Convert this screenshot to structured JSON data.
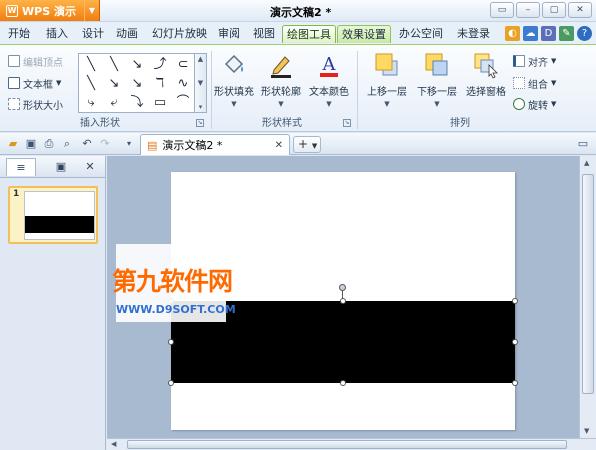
{
  "app": {
    "button_label": "WPS 演示",
    "doc_title": "演示文稿2 *"
  },
  "window_controls": [
    "▭",
    "–",
    "▢",
    "✕"
  ],
  "menu": {
    "tabs": [
      "开始",
      "插入",
      "设计",
      "动画",
      "幻灯片放映",
      "审阅",
      "视图",
      "绘图工具",
      "效果设置",
      "办公空间"
    ],
    "active_tab": "绘图工具",
    "login": "未登录"
  },
  "ribbon": {
    "insert_shape": {
      "edit_points": "编辑顶点",
      "textbox": "文本框",
      "shape_size": "形状大小",
      "label": "插入形状",
      "gallery": [
        "╲",
        "╲",
        "↘",
        "⤴",
        "⊂",
        "╲",
        "↘",
        "↘",
        "ℸ",
        "∿",
        "⤷",
        "⤶",
        "⤵",
        "▭",
        "⌒"
      ]
    },
    "shape_style": {
      "fill": "形状填充",
      "outline": "形状轮廓",
      "text_color": "文本颜色",
      "label": "形状样式"
    },
    "arrange": {
      "bring_forward": "上移一层",
      "send_backward": "下移一层",
      "selection_pane": "选择窗格",
      "align": "对齐",
      "group": "组合",
      "rotate": "旋转",
      "label": "排列"
    }
  },
  "document_tab": {
    "name": "演示文稿2 *"
  },
  "slides_pane": {
    "slide_number": "1"
  },
  "watermark": {
    "cn": "第九软件网",
    "en": "WWW.D9SOFT.COM"
  },
  "colors": {
    "accent_green": "#7dbb45",
    "wps_orange": "#f07d0e",
    "shape_fill": "#000000"
  }
}
